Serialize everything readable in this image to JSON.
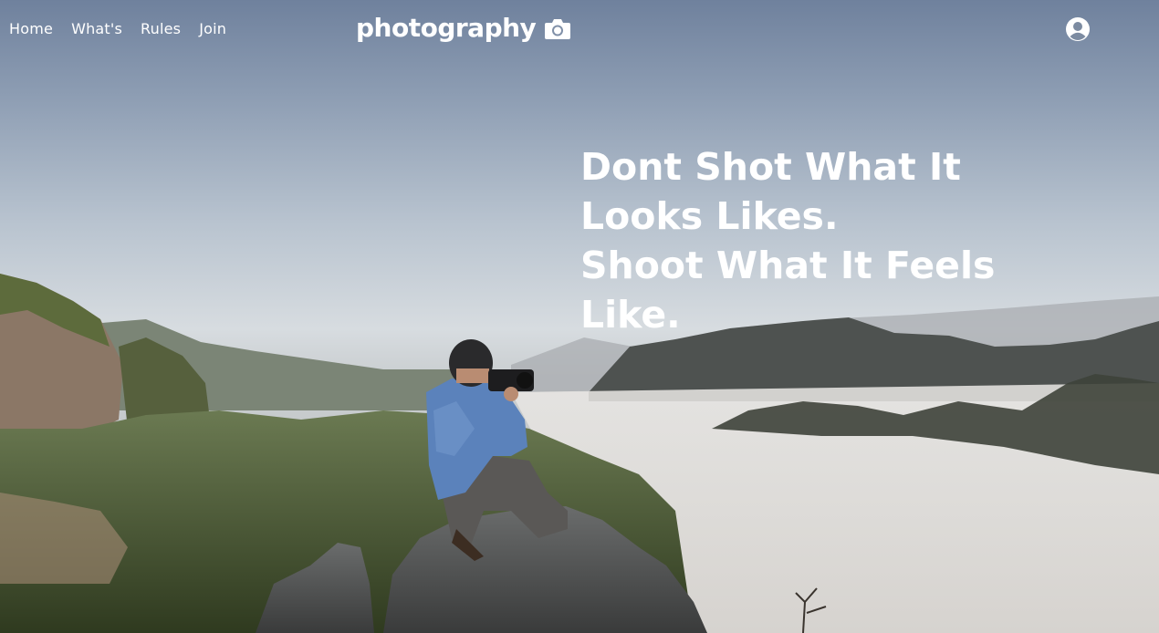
{
  "nav": {
    "items": [
      "Home",
      "What's",
      "Rules",
      "Join"
    ]
  },
  "brand": {
    "name": "photography",
    "icon": "camera-icon"
  },
  "header": {
    "account_icon": "user-circle-icon"
  },
  "hero": {
    "headline_lines": [
      "Dont Shot What It",
      "Looks Likes.",
      "Shoot What It Feels",
      "Like."
    ],
    "accent": "#ffffff"
  }
}
